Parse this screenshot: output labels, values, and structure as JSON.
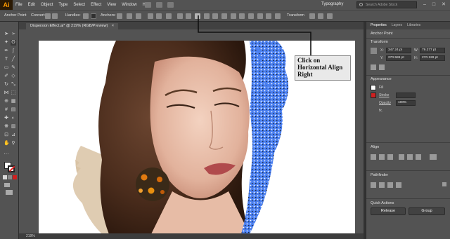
{
  "app": {
    "logo": "Ai"
  },
  "menu": [
    "File",
    "Edit",
    "Object",
    "Type",
    "Select",
    "Effect",
    "View",
    "Window",
    "Help"
  ],
  "workspace": "Typography",
  "search": {
    "placeholder": "Search Adobe Stock"
  },
  "window_controls": [
    "–",
    "□",
    "✕"
  ],
  "control_bar": {
    "anchor_point": "Anchor Point",
    "convert": "Convert:",
    "handles": "Handles:",
    "anchors": "Anchors:",
    "transform": "Transform"
  },
  "document": {
    "tab_title": "Dispersion Effect.ai* @ 219% (RGB/Preview)",
    "close": "×"
  },
  "status": {
    "zoom": "219%"
  },
  "callout": {
    "text": "Click on Horizontal Align Right"
  },
  "panel": {
    "tabs": [
      "Properties",
      "Layers",
      "Libraries"
    ],
    "selection": "Anchor Point",
    "transform": {
      "title": "Transform",
      "x_label": "X:",
      "x": "347.24 pt",
      "y_label": "Y:",
      "y": "270.586 pt",
      "w_label": "W:",
      "w": "79.277 pt",
      "h_label": "H:",
      "h": "270.128 pt"
    },
    "appearance": {
      "title": "Appearance",
      "fill": "Fill",
      "stroke": "Stroke",
      "opacity": "Opacity",
      "opacity_value": "100%",
      "fx": "fx."
    },
    "align": {
      "title": "Align"
    },
    "pathfinder": {
      "title": "Pathfinder"
    },
    "quick_actions": {
      "title": "Quick Actions",
      "release": "Release",
      "group": "Group"
    }
  },
  "colors": {
    "accent": "#ff9a00",
    "blue_particles": "#4a7ff0",
    "panel_bg": "#535353",
    "stroke_swatch": "#d02020"
  }
}
